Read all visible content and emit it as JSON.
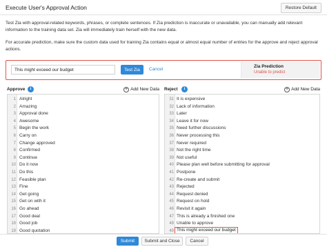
{
  "header": {
    "title": "Execute User's Approval Action",
    "restore_label": "Restore Default"
  },
  "description": {
    "line1": "Test Zia with approval-related keywords, phrases, or complete sentences. If Zia prediction is inaccurate or unavailable, you can manually add relevant information to the training data set. Zia will immediately train herself with the new data.",
    "line2": "For accurate prediction, make sure the custom data used for training Zia contains equal or almost equal number of entries for the approve and reject approval actions."
  },
  "test": {
    "input_value": "This might exceed our budget",
    "test_button": "Test Zia",
    "cancel_label": "Cancel",
    "prediction_title": "Zia Prediction",
    "prediction_status": "Unable to predict"
  },
  "approve": {
    "label": "Approve",
    "add_new": "Add New Data",
    "rows": [
      {
        "n": "1",
        "text": "Alright"
      },
      {
        "n": "2",
        "text": "Amazing"
      },
      {
        "n": "3",
        "text": "Approval done"
      },
      {
        "n": "4",
        "text": "Awesome"
      },
      {
        "n": "5",
        "text": "Begin the work"
      },
      {
        "n": "6",
        "text": "Carry on"
      },
      {
        "n": "7",
        "text": "Change approved"
      },
      {
        "n": "8",
        "text": "Confirmed"
      },
      {
        "n": "9",
        "text": "Continue"
      },
      {
        "n": "10",
        "text": "Do it now"
      },
      {
        "n": "11",
        "text": "Do this"
      },
      {
        "n": "12",
        "text": "Feasible plan"
      },
      {
        "n": "13",
        "text": "Fine"
      },
      {
        "n": "14",
        "text": "Get going"
      },
      {
        "n": "15",
        "text": "Get on with it"
      },
      {
        "n": "16",
        "text": "Go ahead"
      },
      {
        "n": "17",
        "text": "Good deal"
      },
      {
        "n": "18",
        "text": "Good job"
      },
      {
        "n": "19",
        "text": "Good quotation"
      }
    ]
  },
  "reject": {
    "label": "Reject",
    "add_new": "Add New Data",
    "rows": [
      {
        "n": "31",
        "text": "It is expensive"
      },
      {
        "n": "32",
        "text": "Lack of information"
      },
      {
        "n": "33",
        "text": "Later"
      },
      {
        "n": "34",
        "text": "Leave it for now"
      },
      {
        "n": "35",
        "text": "Need further discussions"
      },
      {
        "n": "36",
        "text": "Never processing this"
      },
      {
        "n": "37",
        "text": "Never required"
      },
      {
        "n": "38",
        "text": "Not the right time"
      },
      {
        "n": "39",
        "text": "Not useful"
      },
      {
        "n": "40",
        "text": "Please plan well before submitting for approval"
      },
      {
        "n": "41",
        "text": "Postpone"
      },
      {
        "n": "42",
        "text": "Re-create and submit"
      },
      {
        "n": "43",
        "text": "Rejected"
      },
      {
        "n": "44",
        "text": "Request denied"
      },
      {
        "n": "45",
        "text": "Request on hold"
      },
      {
        "n": "46",
        "text": "Revisit it again"
      },
      {
        "n": "47",
        "text": "This is already a finished one"
      },
      {
        "n": "48",
        "text": "Unable to approve"
      },
      {
        "n": "49",
        "text": "This might exceed our budget"
      }
    ]
  },
  "footer": {
    "submit": "Submit",
    "submit_close": "Submit and Close",
    "cancel": "Cancel"
  },
  "colors": {
    "accent": "#2f89d8",
    "error": "#e0534a"
  },
  "icons": [
    "info-icon",
    "plus-circle-icon"
  ]
}
